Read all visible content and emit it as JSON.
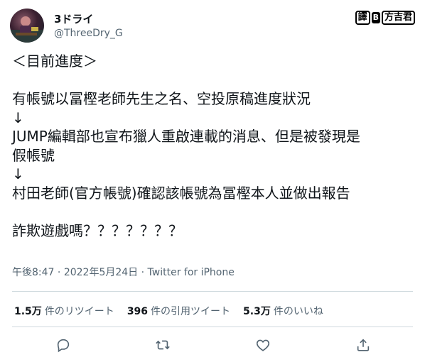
{
  "user": {
    "name": "3ドライ",
    "handle": "@ThreeDry_G"
  },
  "watermark": {
    "left": "譯",
    "mid": "B",
    "right": "方吉君"
  },
  "tweet": {
    "lines": [
      "＜目前進度＞",
      "",
      "有帳號以冨樫老師先生之名、空投原稿進度狀況",
      "↓",
      "JUMP編輯部也宣布獵人重啟連載的消息、但是被發現是",
      "假帳號",
      "↓",
      "村田老師(官方帳號)確認該帳號為冨樫本人並做出報告",
      "",
      "詐欺遊戲嗎？？？？？？？"
    ]
  },
  "meta": {
    "time": "午後8:47",
    "separator1": " · ",
    "date": "2022年5月24日",
    "separator2": " · ",
    "source": "Twitter for iPhone"
  },
  "stats": {
    "retweets_count": "1.5万",
    "retweets_label": "件のリツイート",
    "quotes_count": "396",
    "quotes_label": "件の引用ツイート",
    "likes_count": "5.3万",
    "likes_label": "件のいいね"
  },
  "icons": {
    "reply": "reply-icon",
    "retweet": "retweet-icon",
    "like": "like-icon",
    "share": "share-icon"
  }
}
